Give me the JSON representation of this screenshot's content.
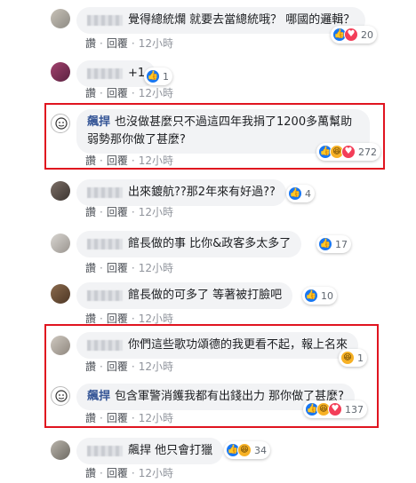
{
  "comments": [
    {
      "name": "",
      "text": "覺得總統爛 就要去當總統哦？ 哪國的邏輯？",
      "actions": {
        "like": "讚",
        "reply": "回覆",
        "time": "12小時"
      },
      "reactions": {
        "icons": [
          "like-icon",
          "love-icon"
        ],
        "count": "20"
      }
    },
    {
      "name": "",
      "text": "+1",
      "actions": {
        "like": "讚",
        "reply": "回覆",
        "time": "12小時"
      },
      "reactions": {
        "icons": [
          "like-icon"
        ],
        "count": "1"
      }
    },
    {
      "name": "飆捍",
      "text": "也沒做甚麼只不過這四年我捐了1200多萬幫助弱勢那你做了甚麼?",
      "actions": {
        "like": "讚",
        "reply": "回覆",
        "time": "12小時"
      },
      "reactions": {
        "icons": [
          "like-icon",
          "haha-icon",
          "love-icon"
        ],
        "count": "272"
      }
    },
    {
      "name": "",
      "text": "出來鍍航??那2年來有好過??",
      "actions": {
        "like": "讚",
        "reply": "回覆",
        "time": "12小時"
      },
      "reactions": {
        "icons": [
          "like-icon"
        ],
        "count": "4"
      }
    },
    {
      "name": "",
      "text": "館長做的事 比你&政客多太多了",
      "actions": {
        "like": "讚",
        "reply": "回覆",
        "time": "12小時"
      },
      "reactions": {
        "icons": [
          "like-icon"
        ],
        "count": "17"
      }
    },
    {
      "name": "",
      "text": "館長做的可多了 等著被打臉吧",
      "actions": {
        "like": "讚",
        "reply": "回覆",
        "time": "12小時"
      },
      "reactions": {
        "icons": [
          "like-icon"
        ],
        "count": "10"
      }
    },
    {
      "name": "",
      "text": "你們這些歌功頌德的我更看不起，報上名來",
      "actions": {
        "like": "讚",
        "reply": "回覆",
        "time": "12小時"
      },
      "reactions": {
        "icons": [
          "haha-icon"
        ],
        "count": "1"
      }
    },
    {
      "name": "飆捍",
      "text": "包含軍警消鑊我都有出錢出力 那你做了甚麼?",
      "actions": {
        "like": "讚",
        "reply": "回覆",
        "time": "12小時"
      },
      "reactions": {
        "icons": [
          "like-icon",
          "haha-icon",
          "love-icon"
        ],
        "count": "137"
      }
    },
    {
      "name": "",
      "text": "飆捍 他只會打獵",
      "actions": {
        "like": "讚",
        "reply": "回覆",
        "time": "12小時"
      },
      "reactions": {
        "icons": [
          "like-icon",
          "haha-icon"
        ],
        "count": "34"
      }
    }
  ],
  "colors": {
    "highlight_box": "#e0141f",
    "name_link": "#385898",
    "bubble_bg": "#f2f3f5",
    "like": "#1877f2",
    "love": "#f33e58",
    "haha": "#f7b125"
  }
}
